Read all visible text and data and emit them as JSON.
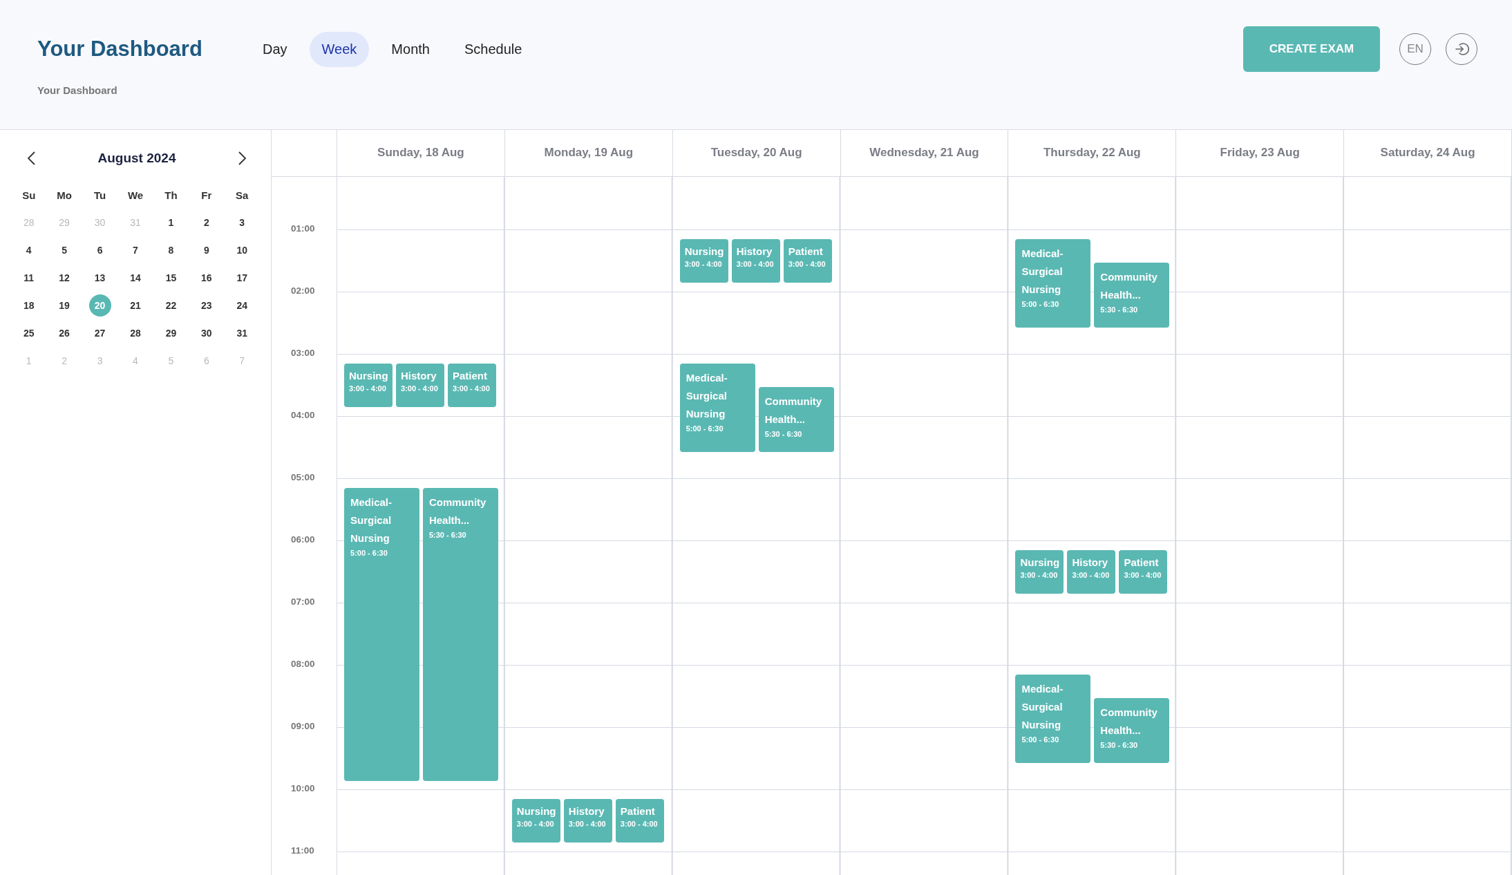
{
  "header": {
    "title": "Your Dashboard",
    "breadcrumb": "Your Dashboard",
    "tabs": [
      {
        "label": "Day",
        "selected": false
      },
      {
        "label": "Week",
        "selected": true
      },
      {
        "label": "Month",
        "selected": false
      },
      {
        "label": "Schedule",
        "selected": false
      }
    ],
    "create_button": "CREATE EXAM",
    "language": "EN"
  },
  "mini_calendar": {
    "month": "August 2024",
    "weekdays": [
      "Su",
      "Mo",
      "Tu",
      "We",
      "Th",
      "Fr",
      "Sa"
    ],
    "weeks": [
      [
        {
          "label": "28",
          "muted": true,
          "selected": false
        },
        {
          "label": "29",
          "muted": true,
          "selected": false
        },
        {
          "label": "30",
          "muted": true,
          "selected": false
        },
        {
          "label": "31",
          "muted": true,
          "selected": false
        },
        {
          "label": "1",
          "muted": false,
          "selected": false
        },
        {
          "label": "2",
          "muted": false,
          "selected": false
        },
        {
          "label": "3",
          "muted": false,
          "selected": false
        }
      ],
      [
        {
          "label": "4",
          "muted": false,
          "selected": false
        },
        {
          "label": "5",
          "muted": false,
          "selected": false
        },
        {
          "label": "6",
          "muted": false,
          "selected": false
        },
        {
          "label": "7",
          "muted": false,
          "selected": false
        },
        {
          "label": "8",
          "muted": false,
          "selected": false
        },
        {
          "label": "9",
          "muted": false,
          "selected": false
        },
        {
          "label": "10",
          "muted": false,
          "selected": false
        }
      ],
      [
        {
          "label": "11",
          "muted": false,
          "selected": false
        },
        {
          "label": "12",
          "muted": false,
          "selected": false
        },
        {
          "label": "13",
          "muted": false,
          "selected": false
        },
        {
          "label": "14",
          "muted": false,
          "selected": false
        },
        {
          "label": "15",
          "muted": false,
          "selected": false
        },
        {
          "label": "16",
          "muted": false,
          "selected": false
        },
        {
          "label": "17",
          "muted": false,
          "selected": false
        }
      ],
      [
        {
          "label": "18",
          "muted": false,
          "selected": false
        },
        {
          "label": "19",
          "muted": false,
          "selected": false
        },
        {
          "label": "20",
          "muted": false,
          "selected": true
        },
        {
          "label": "21",
          "muted": false,
          "selected": false
        },
        {
          "label": "22",
          "muted": false,
          "selected": false
        },
        {
          "label": "23",
          "muted": false,
          "selected": false
        },
        {
          "label": "24",
          "muted": false,
          "selected": false
        }
      ],
      [
        {
          "label": "25",
          "muted": false,
          "selected": false
        },
        {
          "label": "26",
          "muted": false,
          "selected": false
        },
        {
          "label": "27",
          "muted": false,
          "selected": false
        },
        {
          "label": "28",
          "muted": false,
          "selected": false
        },
        {
          "label": "29",
          "muted": false,
          "selected": false
        },
        {
          "label": "30",
          "muted": false,
          "selected": false
        },
        {
          "label": "31",
          "muted": false,
          "selected": false
        }
      ],
      [
        {
          "label": "1",
          "muted": true,
          "selected": false
        },
        {
          "label": "2",
          "muted": true,
          "selected": false
        },
        {
          "label": "3",
          "muted": true,
          "selected": false
        },
        {
          "label": "4",
          "muted": true,
          "selected": false
        },
        {
          "label": "5",
          "muted": true,
          "selected": false
        },
        {
          "label": "6",
          "muted": true,
          "selected": false
        },
        {
          "label": "7",
          "muted": true,
          "selected": false
        }
      ]
    ]
  },
  "week": {
    "days": [
      "Sunday, **18 Aug**",
      "Monday, **19 Aug**",
      "Tuesday, **20 Aug**",
      "Wednesday, **21 Aug**",
      "Thursday, **22 Aug**",
      "Friday, **23 Aug**",
      "Saturday, **24 Aug**"
    ],
    "rows": [
      {
        "time": "01:00",
        "cells": [
          [],
          [],
          [
            {
              "title": "Nursing",
              "time": "3:00 - 4:00",
              "kind": "short"
            },
            {
              "title": "History",
              "time": "3:00 - 4:00",
              "kind": "short"
            },
            {
              "title": "Patient",
              "time": "3:00 - 4:00",
              "kind": "short"
            }
          ],
          [],
          [
            {
              "title": "Medical-Surgical Nursing",
              "time": "5:00 - 6:30",
              "kind": "stacked"
            },
            {
              "title": "Community Health...",
              "time": "5:30 - 6:30",
              "kind": "stacked"
            }
          ],
          [],
          []
        ]
      },
      {
        "time": "02:00",
        "cells": [
          [],
          [],
          [],
          [],
          [],
          [],
          []
        ]
      },
      {
        "time": "03:00",
        "cells": [
          [
            {
              "title": "Nursing",
              "time": "3:00 - 4:00",
              "kind": "short"
            },
            {
              "title": "History",
              "time": "3:00 - 4:00",
              "kind": "short"
            },
            {
              "title": "Patient",
              "time": "3:00 - 4:00",
              "kind": "short"
            }
          ],
          [],
          [
            {
              "title": "Medical-Surgical Nursing",
              "time": "5:00 - 6:30",
              "kind": "stacked"
            },
            {
              "title": "Community Health...",
              "time": "5:30 - 6:30",
              "kind": "stacked"
            }
          ],
          [],
          [],
          [],
          []
        ]
      },
      {
        "time": "04:00",
        "cells": [
          [],
          [],
          [],
          [],
          [],
          [],
          []
        ]
      },
      {
        "time": "05:00",
        "cells": [
          [
            {
              "title": "Medical-Surgical Nursing",
              "time": "5:00 - 6:30",
              "kind": "extended"
            },
            {
              "title": "Community Health...",
              "time": "5:30 - 6:30",
              "kind": "extended"
            }
          ],
          [],
          [],
          [],
          [],
          [],
          []
        ]
      },
      {
        "time": "06:00",
        "cells": [
          [],
          [],
          [],
          [],
          [
            {
              "title": "Nursing",
              "time": "3:00 - 4:00",
              "kind": "short"
            },
            {
              "title": "History",
              "time": "3:00 - 4:00",
              "kind": "short"
            },
            {
              "title": "Patient",
              "time": "3:00 - 4:00",
              "kind": "short"
            }
          ],
          [],
          []
        ]
      },
      {
        "time": "07:00",
        "cells": [
          [],
          [],
          [],
          [],
          [],
          [],
          []
        ]
      },
      {
        "time": "08:00",
        "cells": [
          [],
          [],
          [],
          [],
          [
            {
              "title": "Medical-Surgical Nursing",
              "time": "5:00 - 6:30",
              "kind": "stacked"
            },
            {
              "title": "Community Health...",
              "time": "5:30 - 6:30",
              "kind": "stacked"
            }
          ],
          [],
          []
        ]
      },
      {
        "time": "09:00",
        "cells": [
          [],
          [],
          [],
          [],
          [],
          [],
          []
        ]
      },
      {
        "time": "10:00",
        "cells": [
          [],
          [
            {
              "title": "Nursing",
              "time": "3:00 - 4:00",
              "kind": "short"
            },
            {
              "title": "History",
              "time": "3:00 - 4:00",
              "kind": "short"
            },
            {
              "title": "Patient",
              "time": "3:00 - 4:00",
              "kind": "short"
            }
          ],
          [],
          [],
          [],
          [],
          []
        ]
      },
      {
        "time": "11:00",
        "cells": [
          [],
          [],
          [],
          [],
          [],
          [],
          []
        ]
      }
    ]
  }
}
